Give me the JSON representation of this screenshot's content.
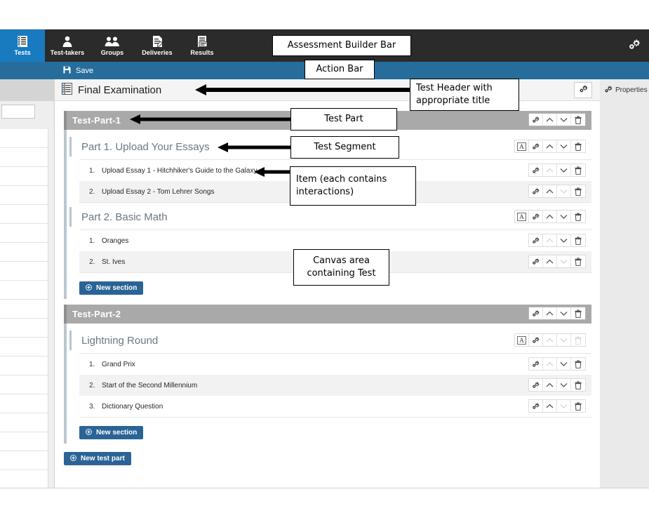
{
  "app": {
    "accent_blue": "#266d9c",
    "nav_background": "#2b2b2b",
    "active_nav_background": "#187abf",
    "part_header_background": "#a9a9a9",
    "button_blue": "#2a6496"
  },
  "nav": {
    "items": [
      {
        "label": "Tests",
        "icon": "tests-icon",
        "active": true
      },
      {
        "label": "Test-takers",
        "icon": "test-takers-icon",
        "active": false
      },
      {
        "label": "Groups",
        "icon": "groups-icon",
        "active": false
      },
      {
        "label": "Deliveries",
        "icon": "deliveries-icon",
        "active": false
      },
      {
        "label": "Results",
        "icon": "results-icon",
        "active": false
      }
    ],
    "settings_icon": "gear-icon"
  },
  "action_bar": {
    "save_label": "Save",
    "save_icon": "save-icon"
  },
  "header": {
    "title": "Final Examination",
    "title_icon": "test-document-icon",
    "settings_icon": "gear-icon",
    "properties_label": "Properties",
    "properties_icon": "gear-icon"
  },
  "canvas": {
    "test_parts": [
      {
        "title": "Test-Part-1",
        "controls": {
          "settings": "gear-icon",
          "up_enabled": true,
          "down_enabled": true,
          "delete_enabled": true
        },
        "sections": [
          {
            "title": "Part 1. Upload Your Essays",
            "controls": {
              "text_icon": "A",
              "settings": "gear-icon",
              "up_enabled": true,
              "down_enabled": true,
              "delete_enabled": true
            },
            "items": [
              {
                "num": "1.",
                "label": "Upload Essay 1 - Hitchhiker's Guide to the Galaxy",
                "up_enabled": false,
                "down_enabled": true
              },
              {
                "num": "2.",
                "label": "Upload Essay 2 - Tom Lehrer Songs",
                "up_enabled": true,
                "down_enabled": false
              }
            ]
          },
          {
            "title": "Part 2. Basic Math",
            "controls": {
              "text_icon": "A",
              "settings": "gear-icon",
              "up_enabled": true,
              "down_enabled": true,
              "delete_enabled": true
            },
            "items": [
              {
                "num": "1.",
                "label": "Oranges",
                "up_enabled": false,
                "down_enabled": true
              },
              {
                "num": "2.",
                "label": "St. Ives",
                "up_enabled": true,
                "down_enabled": false
              }
            ]
          }
        ],
        "new_section_label": "New section"
      },
      {
        "title": "Test-Part-2",
        "controls": {
          "settings": "gear-icon",
          "up_enabled": true,
          "down_enabled": true,
          "delete_enabled": true
        },
        "sections": [
          {
            "title": "Lightning Round",
            "controls": {
              "text_icon": "A",
              "settings": "gear-icon",
              "up_enabled": false,
              "down_enabled": false,
              "delete_enabled": false
            },
            "items": [
              {
                "num": "1.",
                "label": "Grand Prix",
                "up_enabled": false,
                "down_enabled": true
              },
              {
                "num": "2.",
                "label": "Start of the Second Millennium",
                "up_enabled": true,
                "down_enabled": true
              },
              {
                "num": "3.",
                "label": "Dictionary Question",
                "up_enabled": true,
                "down_enabled": false
              }
            ]
          }
        ],
        "new_section_label": "New section"
      }
    ],
    "new_test_part_label": "New test part",
    "new_item_icon": "plus-circle-icon"
  },
  "annotations": [
    {
      "text": "Assessment Builder Bar"
    },
    {
      "text": "Action Bar"
    },
    {
      "text": "Test Header with\nappropriate title"
    },
    {
      "text": "Test Part"
    },
    {
      "text": "Test Segment"
    },
    {
      "text": "Item (each contains\ninteractions)"
    },
    {
      "text": "Canvas area\ncontaining Test"
    }
  ]
}
